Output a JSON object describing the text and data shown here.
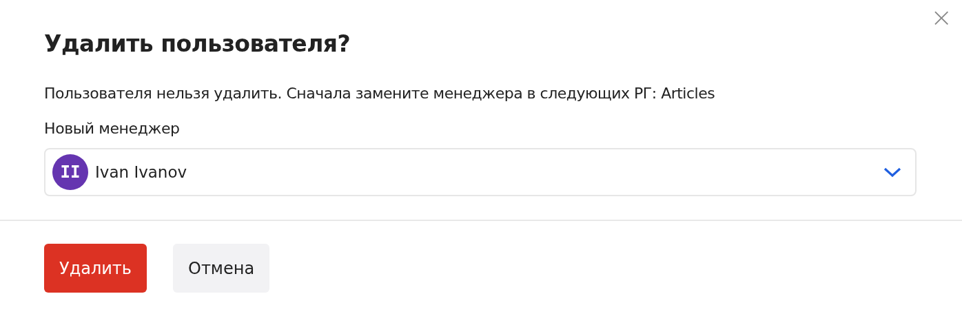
{
  "dialog": {
    "title": "Удалить пользователя?",
    "close": "×"
  },
  "message": "Пользователя нельзя удалить. Сначала замените менеджера в следующих РГ: Articles",
  "field": {
    "label": "Новый менеджер",
    "avatar_initials": "II",
    "value": "Ivan Ivanov"
  },
  "buttons": [
    {
      "label": "Удалить",
      "kind": "danger"
    },
    {
      "label": "Отмена",
      "kind": "secondary"
    }
  ]
}
